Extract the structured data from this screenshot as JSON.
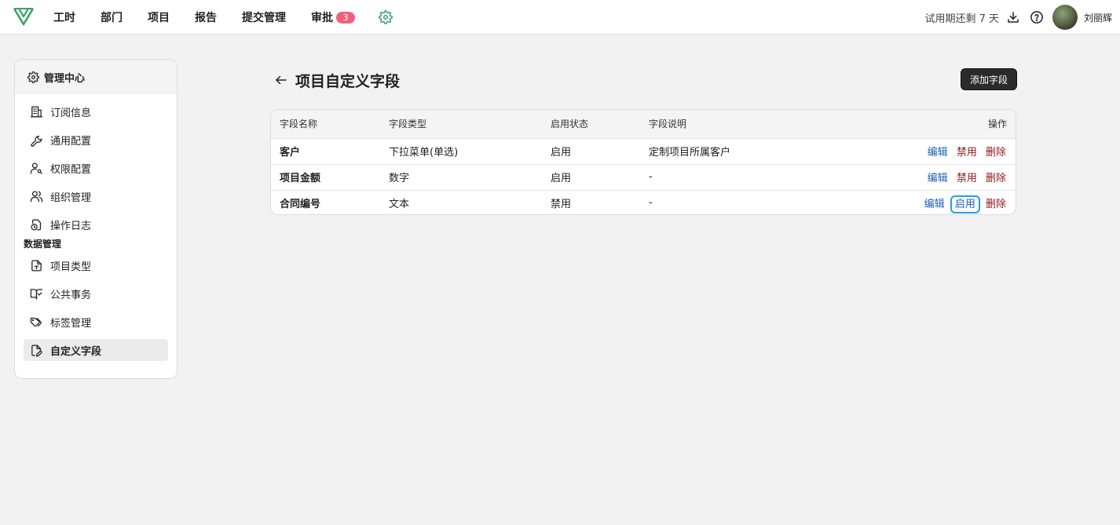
{
  "nav": {
    "items": [
      "工时",
      "部门",
      "项目",
      "报告",
      "提交管理",
      "审批"
    ],
    "approval_badge": "3",
    "accent": "#3aa26d"
  },
  "top_right": {
    "trial": "试用期还剩 7 天",
    "username": "刘丽辉"
  },
  "sidebar": {
    "header": "管理中心",
    "items": [
      {
        "label": "订阅信息",
        "icon": "building-icon"
      },
      {
        "label": "通用配置",
        "icon": "wrench-icon"
      },
      {
        "label": "权限配置",
        "icon": "user-key-icon"
      },
      {
        "label": "组织管理",
        "icon": "users-icon"
      },
      {
        "label": "操作日志",
        "icon": "history-icon"
      }
    ],
    "section": "数据管理",
    "data_items": [
      {
        "label": "项目类型",
        "icon": "file-type-icon"
      },
      {
        "label": "公共事务",
        "icon": "book-check-icon"
      },
      {
        "label": "标签管理",
        "icon": "tags-icon"
      },
      {
        "label": "自定义字段",
        "icon": "file-edit-icon",
        "active": true
      }
    ]
  },
  "main": {
    "title": "项目自定义字段",
    "add_button": "添加字段",
    "columns": [
      "字段名称",
      "字段类型",
      "启用状态",
      "字段说明",
      "操作"
    ],
    "rows": [
      {
        "name": "客户",
        "type": "下拉菜单(单选)",
        "status": "启用",
        "desc": "定制项目所属客户",
        "actions": [
          "编辑",
          "禁用",
          "删除"
        ]
      },
      {
        "name": "项目金额",
        "type": "数字",
        "status": "启用",
        "desc": "-",
        "actions": [
          "编辑",
          "禁用",
          "删除"
        ]
      },
      {
        "name": "合同编号",
        "type": "文本",
        "status": "禁用",
        "desc": "-",
        "actions": [
          "编辑",
          "启用",
          "删除"
        ]
      }
    ]
  }
}
